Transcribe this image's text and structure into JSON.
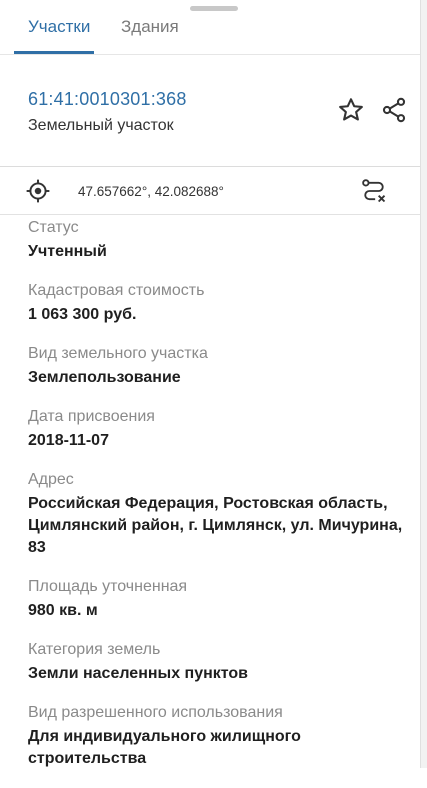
{
  "tabs": [
    {
      "label": "Участки",
      "active": true
    },
    {
      "label": "Здания",
      "active": false
    }
  ],
  "parcel": {
    "cadastral_number": "61:41:0010301:368",
    "type": "Земельный участок"
  },
  "actions": {
    "favorite_icon": "star-outline-icon",
    "share_icon": "share-icon"
  },
  "coordinates": {
    "text": "47.657662°, 42.082688°",
    "locate_icon": "crosshair-icon",
    "route_icon": "route-cancel-icon"
  },
  "fields": [
    {
      "label": "Статус",
      "value": "Учтенный"
    },
    {
      "label": "Кадастровая стоимость",
      "value": "1 063 300 руб."
    },
    {
      "label": "Вид земельного участка",
      "value": "Землепользование"
    },
    {
      "label": "Дата присвоения",
      "value": "2018-11-07"
    },
    {
      "label": "Адрес",
      "value": "Российская Федерация, Ростовская область, Цимлянский район, г. Цимлянск, ул. Мичурина, 83"
    },
    {
      "label": "Площадь уточненная",
      "value": "980 кв. м"
    },
    {
      "label": "Категория земель",
      "value": "Земли населенных пунктов"
    },
    {
      "label": "Вид разрешенного использования",
      "value": "Для индивидуального жилищного строительства"
    }
  ],
  "colors": {
    "accent": "#2f6fa6",
    "label": "#8a8a8a",
    "value": "#1f1f1f"
  }
}
